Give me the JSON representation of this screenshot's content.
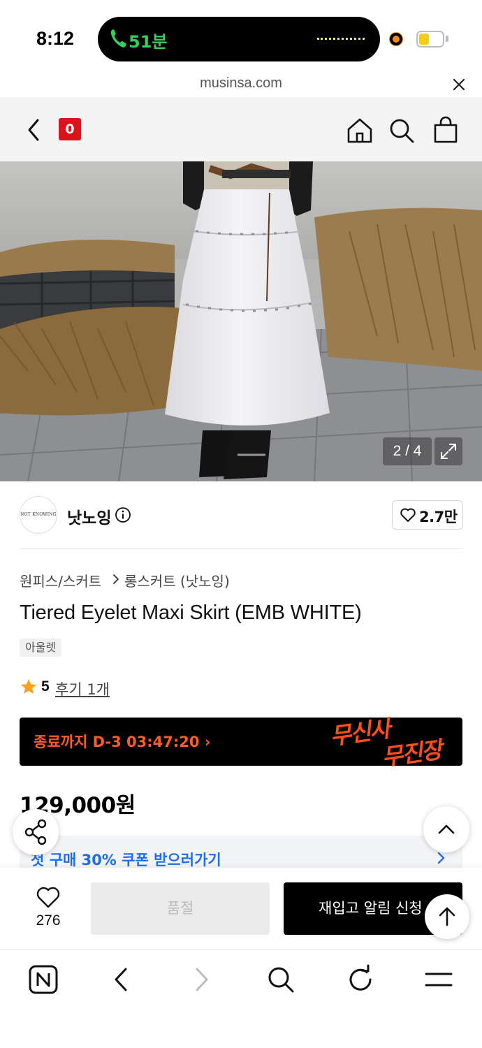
{
  "status_bar": {
    "time": "8:12",
    "call_duration": "51분",
    "battery_color": "#f5cc1b"
  },
  "browser": {
    "url": "musinsa.com"
  },
  "header": {
    "logo_text": "0",
    "icons": [
      "back-icon",
      "home-icon",
      "search-icon",
      "bag-icon"
    ]
  },
  "gallery": {
    "counter": "2 / 4"
  },
  "brand": {
    "avatar_text": "NOT KNOWING",
    "name": "낫노잉",
    "likes": "2.7만"
  },
  "breadcrumb": {
    "category": "원피스/스커트",
    "subcategory": "롱스커트 (낫노잉)"
  },
  "product": {
    "title": "Tiered Eyelet Maxi Skirt (EMB WHITE)",
    "tag": "아울렛",
    "rating": "5",
    "reviews": "후기 1개",
    "price": "129,000원"
  },
  "sale_banner": {
    "countdown": "종료까지 D-3 03:47:20 ›",
    "logo_line1": "무신사",
    "logo_line2": "무진장",
    "accent": "#ff5a2a"
  },
  "coupon": {
    "text": "첫 구매 30% 쿠폰 받으러가기",
    "color": "#1f6ee8"
  },
  "purchase_bar": {
    "wish_count": "276",
    "soldout_label": "품절",
    "restock_label": "재입고 알림 신청"
  }
}
